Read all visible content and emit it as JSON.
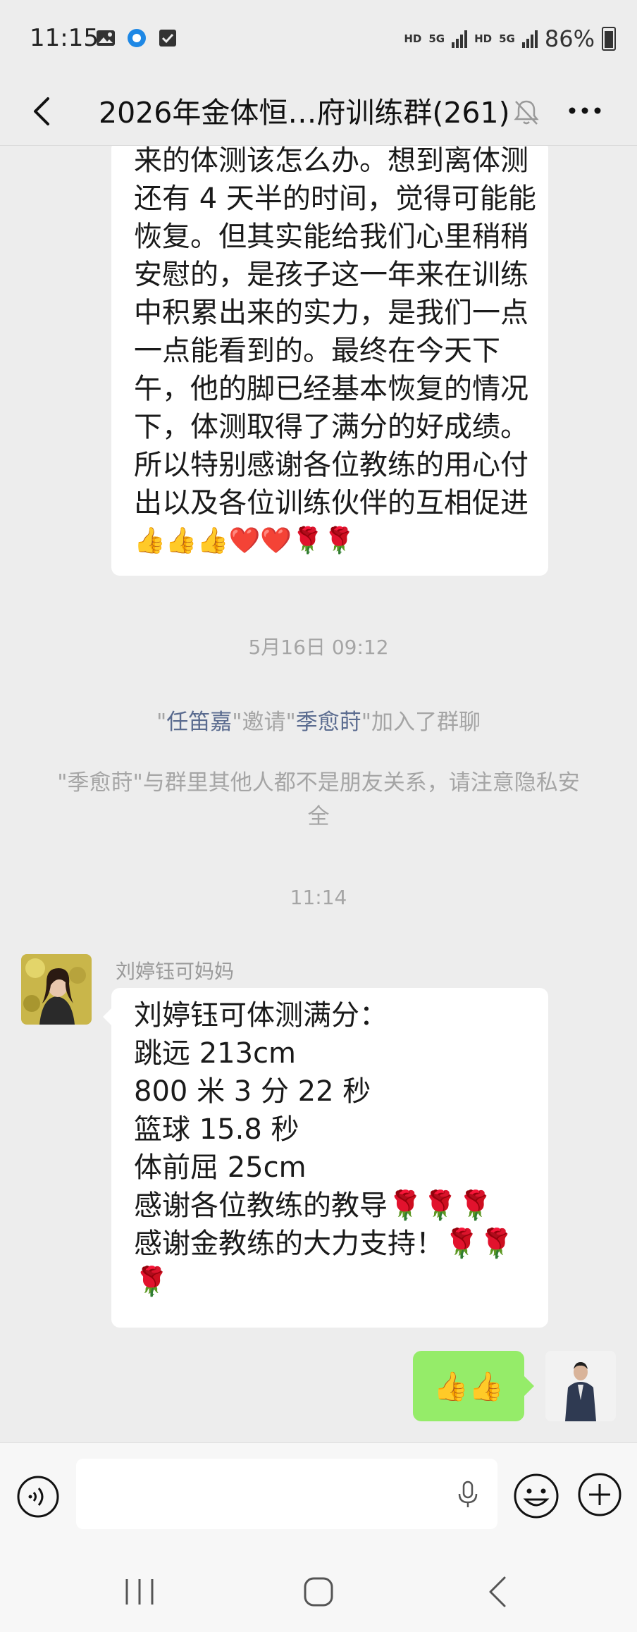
{
  "status": {
    "time": "11:15",
    "hd1": "HD",
    "net1": "5G",
    "hd2": "HD",
    "net2": "5G",
    "battery": "86%"
  },
  "header": {
    "title": "2026年金体恒…府训练群(261)"
  },
  "messages": {
    "top_lines": [
      "来的体测该怎么办。想到离体测",
      "还有 4 天半的时间，觉得可能能",
      "恢复。但其实能给我们心里稍稍",
      "安慰的，是孩子这一年来在训练",
      "中积累出来的实力，是我们一点",
      "一点能看到的。最终在今天下",
      "午，他的脚已经基本恢复的情况",
      "下，体测取得了满分的好成绩。",
      "所以特别感谢各位教练的用心付",
      "出以及各位训练伙伴的互相促进"
    ],
    "top_emoji": "👍👍👍❤️❤️🌹🌹",
    "timestamp1": "5月16日 09:12",
    "invite": {
      "q1": "\"",
      "inviter": "任笛嘉",
      "q2": "\"邀请\"",
      "invitee": "季愈莳",
      "q3": "\"加入了群聊"
    },
    "privacy_notice": "\"季愈莳\"与群里其他人都不是朋友关系，请注意隐私安全",
    "timestamp2": "11:14",
    "sender_name": "刘婷钰可妈妈",
    "msg_lines": [
      "刘婷钰可体测满分：",
      "跳远 213cm",
      "800 米 3 分 22 秒",
      "篮球 15.8 秒",
      "体前屈 25cm",
      "感谢各位教练的教导🌹🌹🌹",
      "感谢金教练的大力支持！🌹🌹",
      "🌹"
    ],
    "my_reply": "👍👍"
  }
}
